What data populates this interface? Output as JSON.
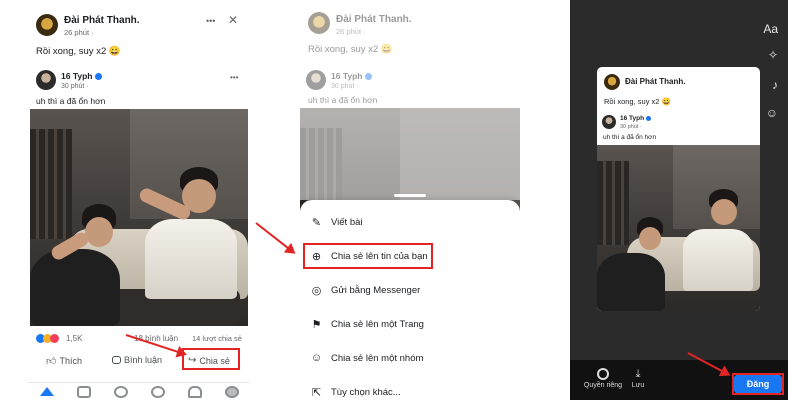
{
  "post": {
    "page_name": "Đài Phát Thanh.",
    "time": "26 phút ·",
    "caption": "Rồi xong, suy x2 😀",
    "shared": {
      "author": "16 Typh",
      "time": "30 phút ·",
      "text": "uh thì a đã ổn hơn"
    },
    "reaction_count": "1,5K",
    "comments": "18 bình luận",
    "shares": "14 lượt chia sẻ"
  },
  "actions": {
    "like": "Thích",
    "comment": "Bình luận",
    "share": "Chia sẻ"
  },
  "menu": {
    "dots": "•••",
    "close": "✕"
  },
  "share_sheet": {
    "items": [
      {
        "label": "Viết bài",
        "icon": "edit-icon"
      },
      {
        "label": "Chia sẻ lên tin của bạn",
        "icon": "plus-circle-icon"
      },
      {
        "label": "Gửi bằng Messenger",
        "icon": "messenger-icon"
      },
      {
        "label": "Chia sẻ lên một Trang",
        "icon": "flag-icon"
      },
      {
        "label": "Chia sẻ lên một nhóm",
        "icon": "group-icon"
      },
      {
        "label": "Tùy chọn khác...",
        "icon": "external-icon"
      }
    ]
  },
  "story_editor": {
    "tools": [
      "Aa"
    ],
    "privacy_label": "Quyền riêng",
    "save_label": "Lưu",
    "post_button": "Đăng"
  },
  "colors": {
    "accent": "#1877f2",
    "highlight": "#e32424"
  }
}
